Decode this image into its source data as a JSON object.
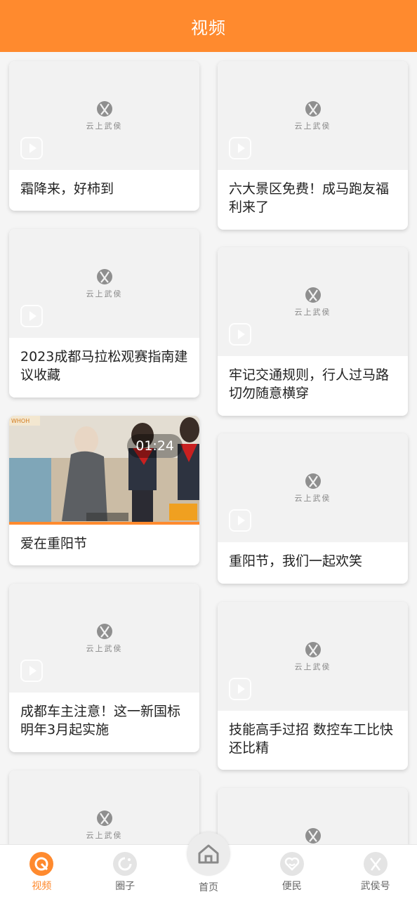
{
  "header": {
    "title": "视频"
  },
  "placeholder_logo_text": "云上武侯",
  "videos": [
    {
      "title": "霜降来，好柿到"
    },
    {
      "title": "六大景区免费！成马跑友福利来了"
    },
    {
      "title": "2023成都马拉松观赛指南建议收藏"
    },
    {
      "title": "牢记交通规则，行人过马路切勿随意横穿"
    },
    {
      "title": "爱在重阳节",
      "duration": "01:24"
    },
    {
      "title": "重阳节，我们一起欢笑"
    },
    {
      "title": "成都车主注意！这一新国标明年3月起实施"
    },
    {
      "title": "技能高手过招 数控车工比快还比精"
    },
    {
      "title": ""
    },
    {
      "title": ""
    }
  ],
  "tabbar": {
    "items": [
      {
        "label": "视频",
        "icon": "video-icon",
        "active": true
      },
      {
        "label": "圈子",
        "icon": "circle-icon"
      },
      {
        "label": "首页",
        "icon": "home-icon"
      },
      {
        "label": "便民",
        "icon": "heart-icon"
      },
      {
        "label": "武侯号",
        "icon": "wuhou-icon"
      }
    ]
  },
  "colors": {
    "accent": "#ff8a2e",
    "placeholder_bg": "#f2f2f2"
  }
}
